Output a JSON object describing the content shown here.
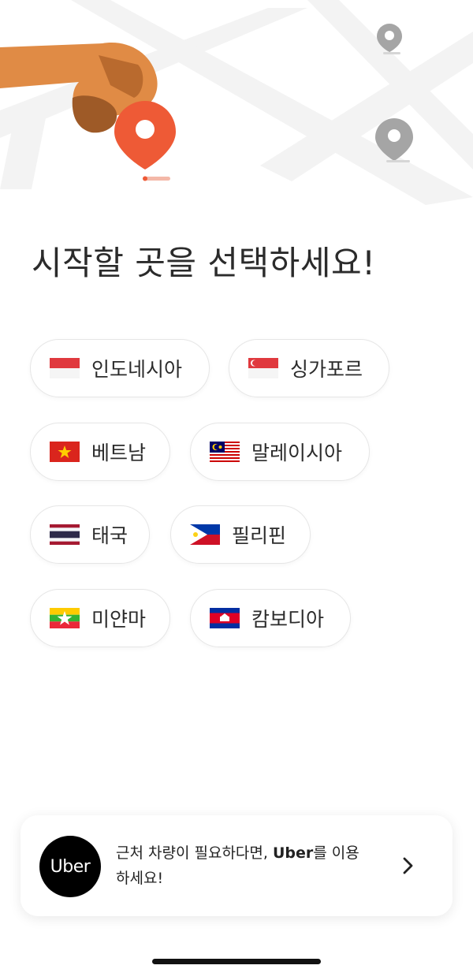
{
  "page_title": "시작할 곳을 선택하세요!",
  "countries": [
    {
      "label": "인도네시아",
      "flag": "indonesia-flag"
    },
    {
      "label": "싱가포르",
      "flag": "singapore-flag"
    },
    {
      "label": "베트남",
      "flag": "vietnam-flag"
    },
    {
      "label": "말레이시아",
      "flag": "malaysia-flag"
    },
    {
      "label": "태국",
      "flag": "thailand-flag"
    },
    {
      "label": "필리핀",
      "flag": "philippines-flag"
    },
    {
      "label": "미얀마",
      "flag": "myanmar-flag"
    },
    {
      "label": "캄보디아",
      "flag": "cambodia-flag"
    }
  ],
  "uber_banner": {
    "logo_text": "Uber",
    "text_before": "근처 차량이 필요하다면, ",
    "brand": "Uber",
    "text_after": "를 이용하세요!",
    "chevron_icon": "chevron-right-icon"
  },
  "colors": {
    "pin_accent": "#EE5A36",
    "hand_skin": "#E08B45",
    "pin_gray": "#A5A5A5"
  }
}
